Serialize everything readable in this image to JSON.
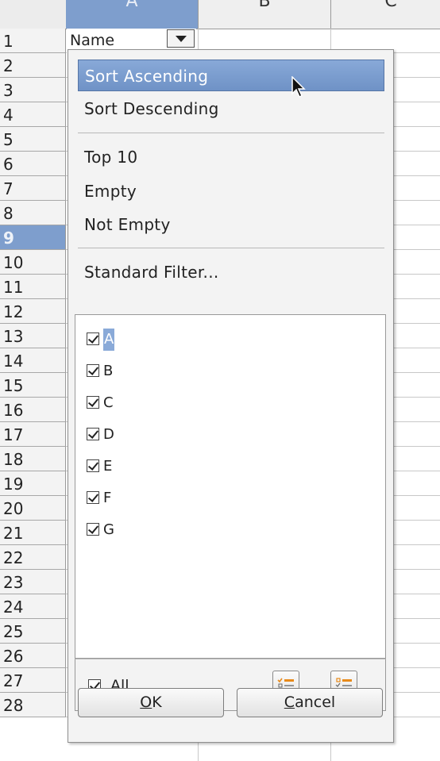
{
  "sheet": {
    "columns": [
      "A",
      "B",
      "C"
    ],
    "selected_column": "A",
    "rows": [
      "1",
      "2",
      "3",
      "4",
      "5",
      "6",
      "7",
      "8",
      "9",
      "10",
      "11",
      "12",
      "13",
      "14",
      "15",
      "16",
      "17",
      "18",
      "19",
      "20",
      "21",
      "22",
      "23",
      "24",
      "25",
      "26",
      "27",
      "28"
    ],
    "selected_row": "9",
    "cell_a1": "Name"
  },
  "autofilter": {
    "menu": [
      {
        "label": "Sort Ascending",
        "highlighted": true
      },
      {
        "label": "Sort Descending"
      },
      {
        "label": "Top 10"
      },
      {
        "label": "Empty"
      },
      {
        "label": "Not Empty"
      },
      {
        "label": "Standard Filter..."
      }
    ],
    "values": [
      {
        "label": "A",
        "checked": true
      },
      {
        "label": "B",
        "checked": true
      },
      {
        "label": "C",
        "checked": true
      },
      {
        "label": "D",
        "checked": true
      },
      {
        "label": "E",
        "checked": true
      },
      {
        "label": "F",
        "checked": true
      },
      {
        "label": "G",
        "checked": true
      }
    ],
    "all_label": "All",
    "all_checked": true,
    "ok_label": "OK",
    "ok_mnemonic": "O",
    "ok_rest": "K",
    "cancel_label": "Cancel",
    "cancel_mnemonic": "C",
    "cancel_rest": "ancel",
    "select_current_icon": "select-current-only-icon",
    "unselect_current_icon": "unselect-current-icon"
  },
  "colors": {
    "selection": "#7e9ecd",
    "highlight": "#7399cf",
    "icon_accent": "#e88a1a"
  }
}
